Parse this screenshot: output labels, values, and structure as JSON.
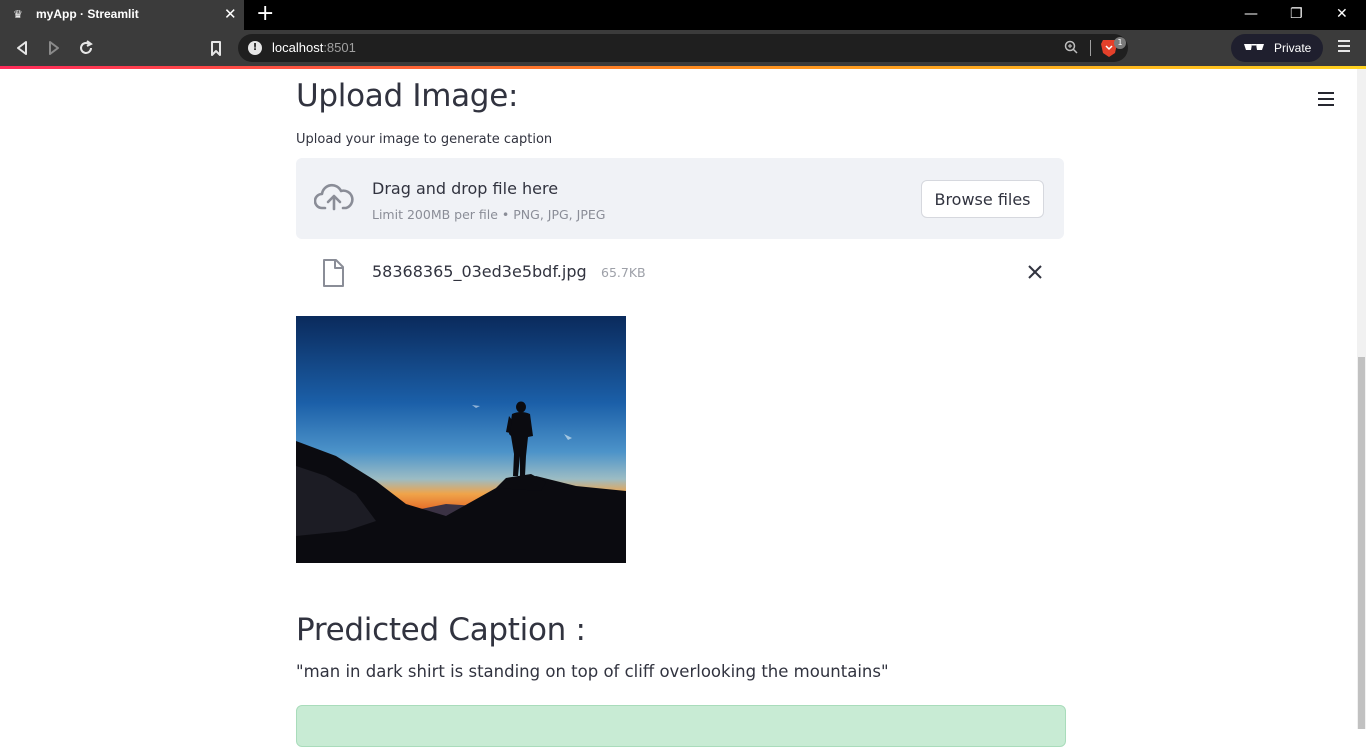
{
  "browser": {
    "tab_title": "myApp · Streamlit",
    "url_host": "localhost",
    "url_port": ":8501",
    "private_label": "Private",
    "shield_count": "1"
  },
  "page": {
    "upload_heading": "Upload Image:",
    "uploader": {
      "label": "Upload your image to generate caption",
      "drop_title": "Drag and drop file here",
      "limit_text": "Limit 200MB per file • PNG, JPG, JPEG",
      "browse_label": "Browse files"
    },
    "uploaded_file": {
      "name": "58368365_03ed3e5bdf.jpg",
      "size": "65.7KB"
    },
    "caption_heading": "Predicted Caption :",
    "caption": "\"man in dark shirt is standing on top of cliff overlooking the mountains\""
  },
  "colors": {
    "text": "#31333f",
    "dropzone_bg": "#f0f2f6",
    "success_bg": "#c8ebd4"
  }
}
